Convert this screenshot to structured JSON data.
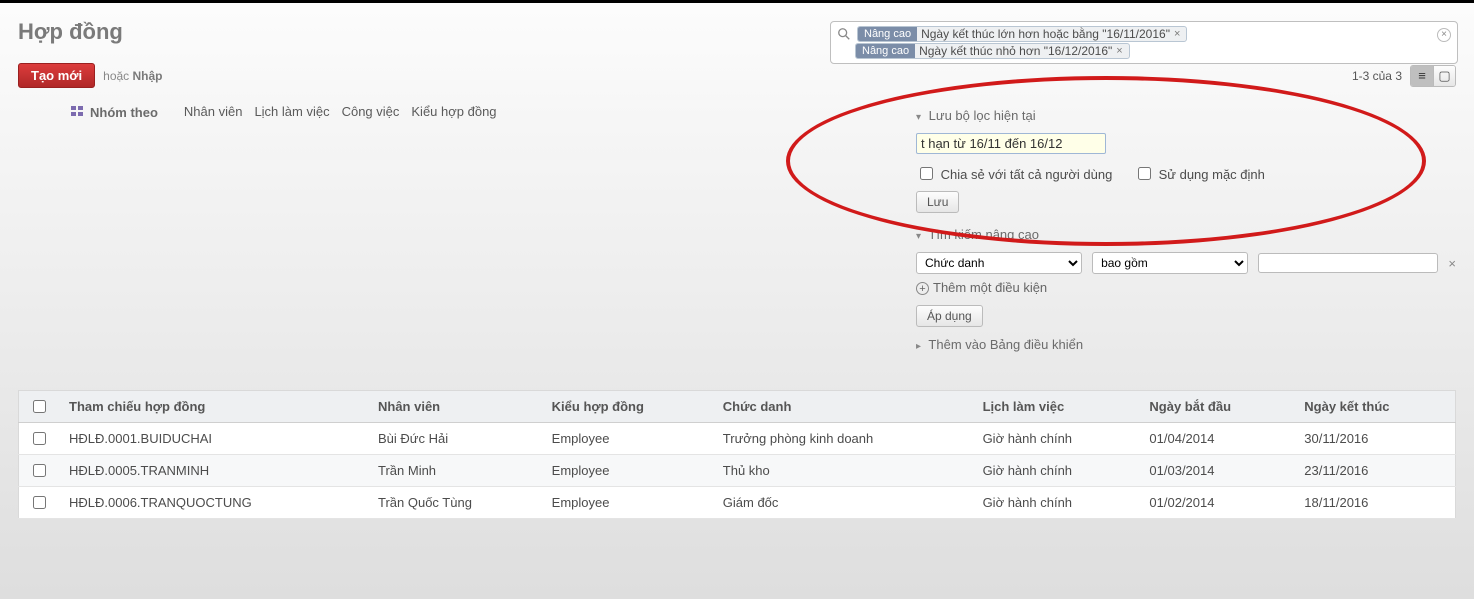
{
  "header": {
    "title": "Hợp đồng"
  },
  "search": {
    "facet_badge": "Nâng cao",
    "filters": [
      "Ngày kết thúc lớn hơn hoặc bằng \"16/11/2016\"",
      "Ngày kết thúc nhỏ hơn \"16/12/2016\""
    ]
  },
  "toolbar": {
    "create_label": "Tạo mới",
    "or_text": "hoặc",
    "import_label": "Nhập",
    "pager_text": "1-3 của 3"
  },
  "groupby": {
    "label": "Nhóm theo",
    "options": [
      "Nhân viên",
      "Lịch làm việc",
      "Công việc",
      "Kiểu hợp đồng"
    ]
  },
  "save_filter": {
    "title": "Lưu bộ lọc hiện tại",
    "value": "t hạn từ 16/11 đến 16/12",
    "share_label": "Chia sẻ với tất cả người dùng",
    "default_label": "Sử dụng mặc định",
    "save_button": "Lưu"
  },
  "advanced": {
    "title": "Tìm kiếm nâng cao",
    "field": "Chức danh",
    "operator": "bao gồm",
    "value": "",
    "add_cond": "Thêm một điều kiện",
    "apply": "Áp dụng"
  },
  "dashboard_add": {
    "label": "Thêm vào Bảng điều khiển"
  },
  "table": {
    "headers": {
      "ref": "Tham chiếu hợp đồng",
      "emp": "Nhân viên",
      "ctype": "Kiểu hợp đồng",
      "job": "Chức danh",
      "sched": "Lịch làm việc",
      "start": "Ngày bắt đầu",
      "end": "Ngày kết thúc"
    },
    "rows": [
      {
        "ref": "HĐLĐ.0001.BUIDUCHAI",
        "emp": "Bùi Đức Hải",
        "ctype": "Employee",
        "job": "Trưởng phòng kinh doanh",
        "sched": "Giờ hành chính",
        "start": "01/04/2014",
        "end": "30/11/2016"
      },
      {
        "ref": "HĐLĐ.0005.TRANMINH",
        "emp": "Trần Minh",
        "ctype": "Employee",
        "job": "Thủ kho",
        "sched": "Giờ hành chính",
        "start": "01/03/2014",
        "end": "23/11/2016"
      },
      {
        "ref": "HĐLĐ.0006.TRANQUOCTUNG",
        "emp": "Trần Quốc Tùng",
        "ctype": "Employee",
        "job": "Giám đốc",
        "sched": "Giờ hành chính",
        "start": "01/02/2014",
        "end": "18/11/2016"
      }
    ]
  }
}
